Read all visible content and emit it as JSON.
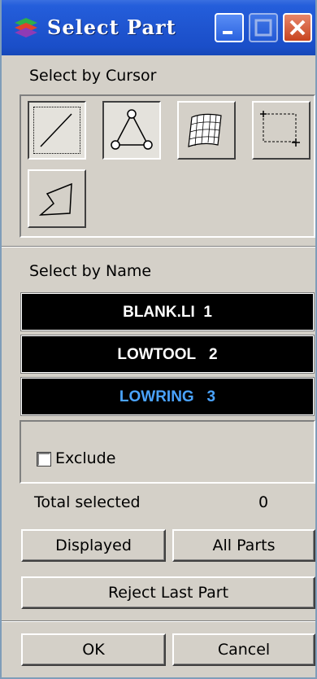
{
  "window": {
    "title": "Select Part"
  },
  "cursor_section": {
    "label": "Select by Cursor",
    "tools": [
      "line-select-icon",
      "triangle-nodes-icon",
      "mesh-surface-icon",
      "box-select-icon",
      "polygon-select-icon"
    ]
  },
  "name_section": {
    "label": "Select by Name",
    "parts": [
      {
        "name": "BLANK.LI",
        "id": "1",
        "selected": false
      },
      {
        "name": "LOWTOOL",
        "id": "2",
        "selected": false
      },
      {
        "name": "LOWRING",
        "id": "3",
        "selected": true
      }
    ]
  },
  "exclude": {
    "label": "Exclude",
    "checked": false
  },
  "total": {
    "label": "Total selected",
    "value": "0"
  },
  "buttons": {
    "displayed": "Displayed",
    "all_parts": "All Parts",
    "reject_last": "Reject Last Part",
    "ok": "OK",
    "cancel": "Cancel"
  },
  "colors": {
    "title_bar": "#245edb",
    "list_bg": "#000000",
    "selected_text": "#4aa3ff"
  }
}
